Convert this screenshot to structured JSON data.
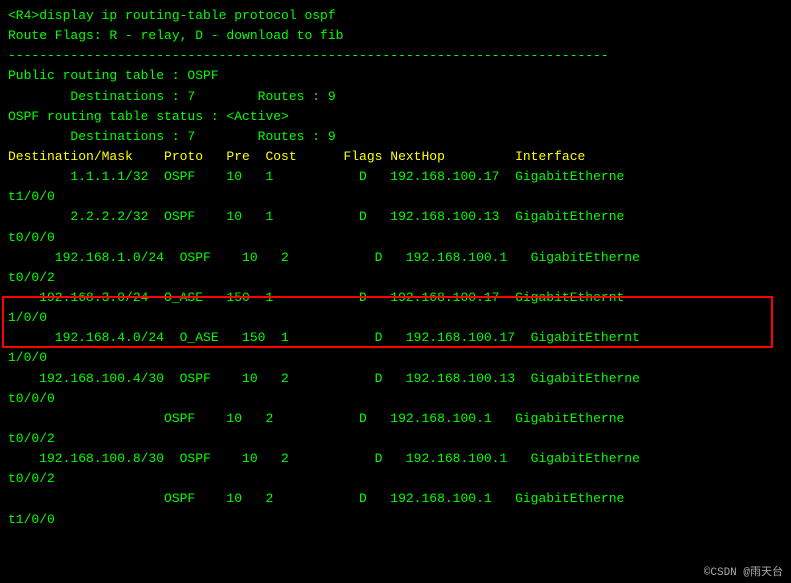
{
  "terminal": {
    "lines": [
      {
        "text": "<R4>display ip routing-table protocol ospf",
        "style": "normal"
      },
      {
        "text": "Route Flags: R - relay, D - download to fib",
        "style": "normal"
      },
      {
        "text": "-----------------------------------------------------------------------------",
        "style": "normal"
      },
      {
        "text": "",
        "style": "normal"
      },
      {
        "text": "Public routing table : OSPF",
        "style": "normal"
      },
      {
        "text": "        Destinations : 7        Routes : 9",
        "style": "normal"
      },
      {
        "text": "",
        "style": "normal"
      },
      {
        "text": "OSPF routing table status : <Active>",
        "style": "normal"
      },
      {
        "text": "        Destinations : 7        Routes : 9",
        "style": "normal"
      },
      {
        "text": "",
        "style": "normal"
      },
      {
        "text": "Destination/Mask    Proto   Pre  Cost      Flags NextHop         Interface",
        "style": "yellow"
      },
      {
        "text": "",
        "style": "normal"
      },
      {
        "text": "        1.1.1.1/32  OSPF    10   1           D   192.168.100.17  GigabitEtherne",
        "style": "normal"
      },
      {
        "text": "t1/0/0",
        "style": "normal"
      },
      {
        "text": "        2.2.2.2/32  OSPF    10   1           D   192.168.100.13  GigabitEtherne",
        "style": "normal"
      },
      {
        "text": "t0/0/0",
        "style": "normal"
      },
      {
        "text": "      192.168.1.0/24  OSPF    10   2           D   192.168.100.1   GigabitEtherne",
        "style": "normal"
      },
      {
        "text": "t0/0/2",
        "style": "normal"
      },
      {
        "text": "    192.168.3.0/24  O_ASE   150  1           D   192.168.100.17  GigabitEthernt",
        "style": "highlighted"
      },
      {
        "text": "1/0/0",
        "style": "highlighted"
      },
      {
        "text": "      192.168.4.0/24  O_ASE   150  1           D   192.168.100.17  GigabitEthernt",
        "style": "highlighted"
      },
      {
        "text": "1/0/0",
        "style": "highlighted"
      },
      {
        "text": "    192.168.100.4/30  OSPF    10   2           D   192.168.100.13  GigabitEtherne",
        "style": "normal"
      },
      {
        "text": "t0/0/0",
        "style": "normal"
      },
      {
        "text": "                    OSPF    10   2           D   192.168.100.1   GigabitEtherne",
        "style": "normal"
      },
      {
        "text": "t0/0/2",
        "style": "normal"
      },
      {
        "text": "    192.168.100.8/30  OSPF    10   2           D   192.168.100.1   GigabitEtherne",
        "style": "normal"
      },
      {
        "text": "t0/0/2",
        "style": "normal"
      },
      {
        "text": "                    OSPF    10   2           D   192.168.100.1   GigabitEtherne",
        "style": "normal"
      },
      {
        "text": "t1/0/0",
        "style": "normal"
      }
    ],
    "watermark": "©CSDN @雨天台"
  }
}
